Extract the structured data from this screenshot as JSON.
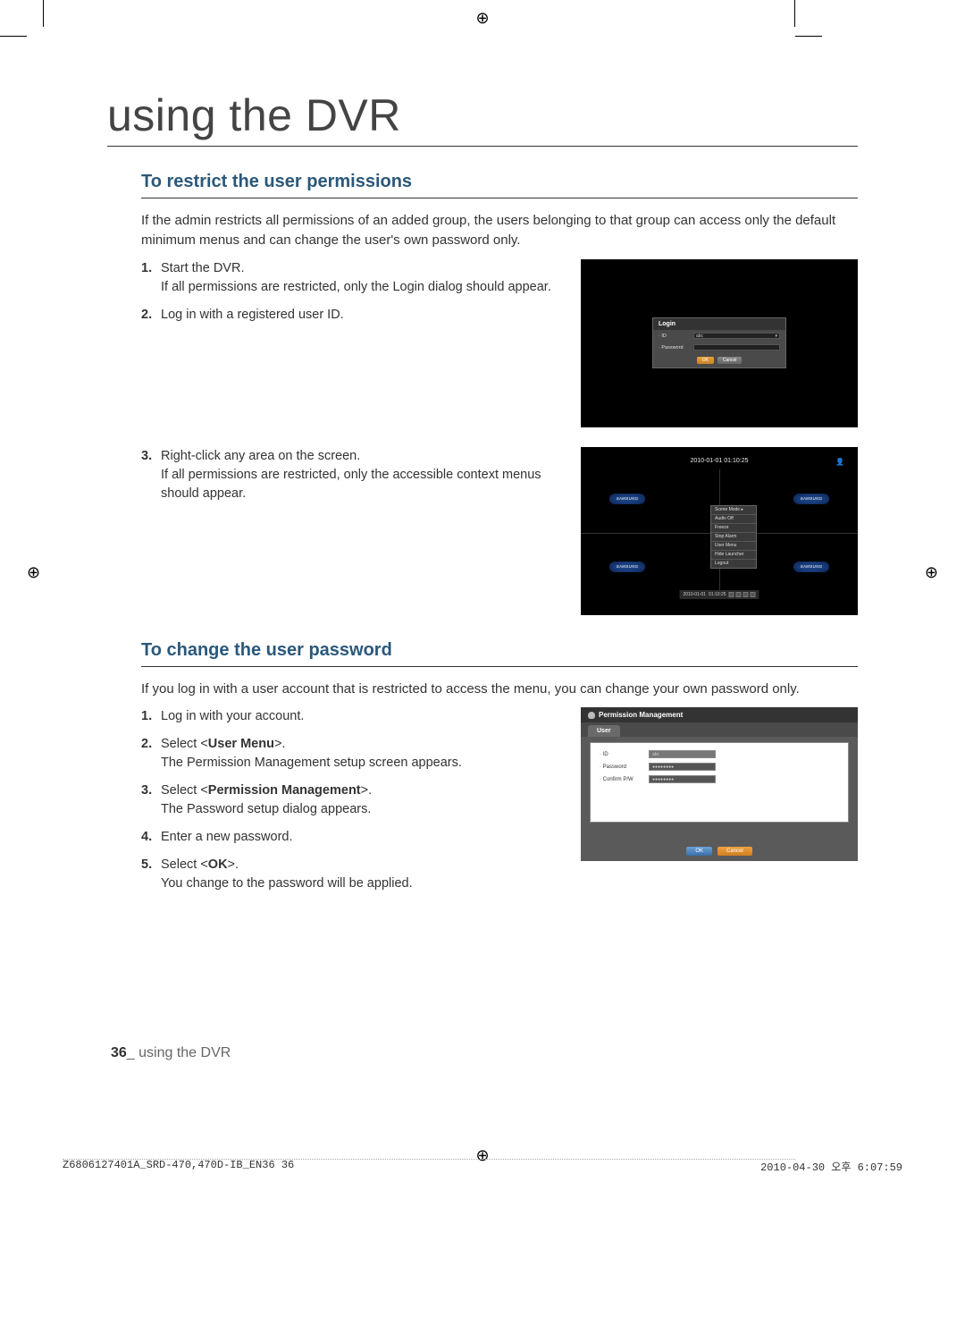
{
  "chapter_title": "using the DVR",
  "section1": {
    "title": "To restrict the user permissions",
    "intro": "If the admin restricts all permissions of an added group, the users belonging to that group can access only the default minimum menus and can change the user's own password only.",
    "steps": [
      {
        "text": "Start the DVR.",
        "sub": "If all permissions are restricted, only the Login dialog should appear."
      },
      {
        "text": "Log in with a registered user ID."
      },
      {
        "text": "Right-click any area on the screen.",
        "sub": "If all permissions are restricted, only the accessible context menus should appear."
      }
    ]
  },
  "login_dialog": {
    "title": "Login",
    "id_label": "· ID",
    "id_value": "abc",
    "pw_label": "· Password",
    "ok": "OK",
    "cancel": "Cancel"
  },
  "context_screen": {
    "date_time": "2010-01-01 01:10:25",
    "bottom_date": "2010-01-01",
    "bottom_time": "01:10:25",
    "logo": "SAMSUNG",
    "menu": [
      "Scene Mode  ▸",
      "Audio Off",
      "Freeze",
      "Stop Alarm",
      "User Menu",
      "Hide Launcher",
      "Logout"
    ]
  },
  "section2": {
    "title": "To change the user password",
    "intro": "If you log in with a user account that is restricted to access the menu, you can change your own password only.",
    "steps": [
      {
        "text": "Log in with your account."
      },
      {
        "text_pre": "Select <",
        "bold": "User Menu",
        "text_post": ">.",
        "sub": "The Permission Management setup screen appears."
      },
      {
        "text_pre": "Select <",
        "bold": "Permission Management",
        "text_post": ">.",
        "sub": "The Password setup dialog appears."
      },
      {
        "text": "Enter a new password."
      },
      {
        "text_pre": "Select <",
        "bold": "OK",
        "text_post": ">.",
        "sub": "You change to the password will be applied."
      }
    ]
  },
  "pm_dialog": {
    "title": "Permission Management",
    "tab": "User",
    "id_label": "· ID",
    "id_value": "abc",
    "pw_label": "· Password",
    "pw_value": "●●●●●●●●",
    "cpw_label": "· Confirm P/W",
    "cpw_value": "●●●●●●●●",
    "ok": "OK",
    "cancel": "Cancel"
  },
  "footer": {
    "page_number": "36",
    "page_label": "_ using the DVR"
  },
  "meta": {
    "filepath": "Z6806127401A_SRD-470,470D-IB_EN36   36",
    "timestamp": "2010-04-30   오후 6:07:59"
  }
}
